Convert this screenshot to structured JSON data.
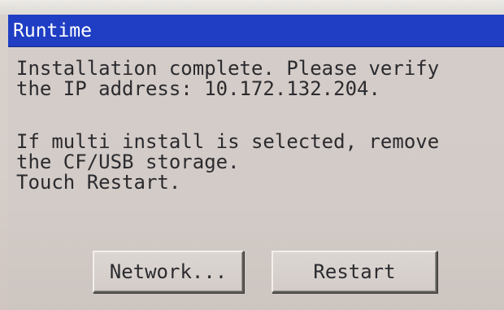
{
  "window": {
    "title": "Runtime"
  },
  "message": {
    "lines1": [
      "Installation complete. Please verify",
      "the IP address: 10.172.132.204."
    ],
    "lines2": [
      "If multi install is selected, remove",
      "the CF/USB storage.",
      "Touch Restart."
    ]
  },
  "buttons": {
    "network_label": "Network...",
    "restart_label": "Restart"
  },
  "colors": {
    "titlebar": "#1f3ec4",
    "background": "#d4ccc8",
    "text": "#2b2b2f"
  }
}
